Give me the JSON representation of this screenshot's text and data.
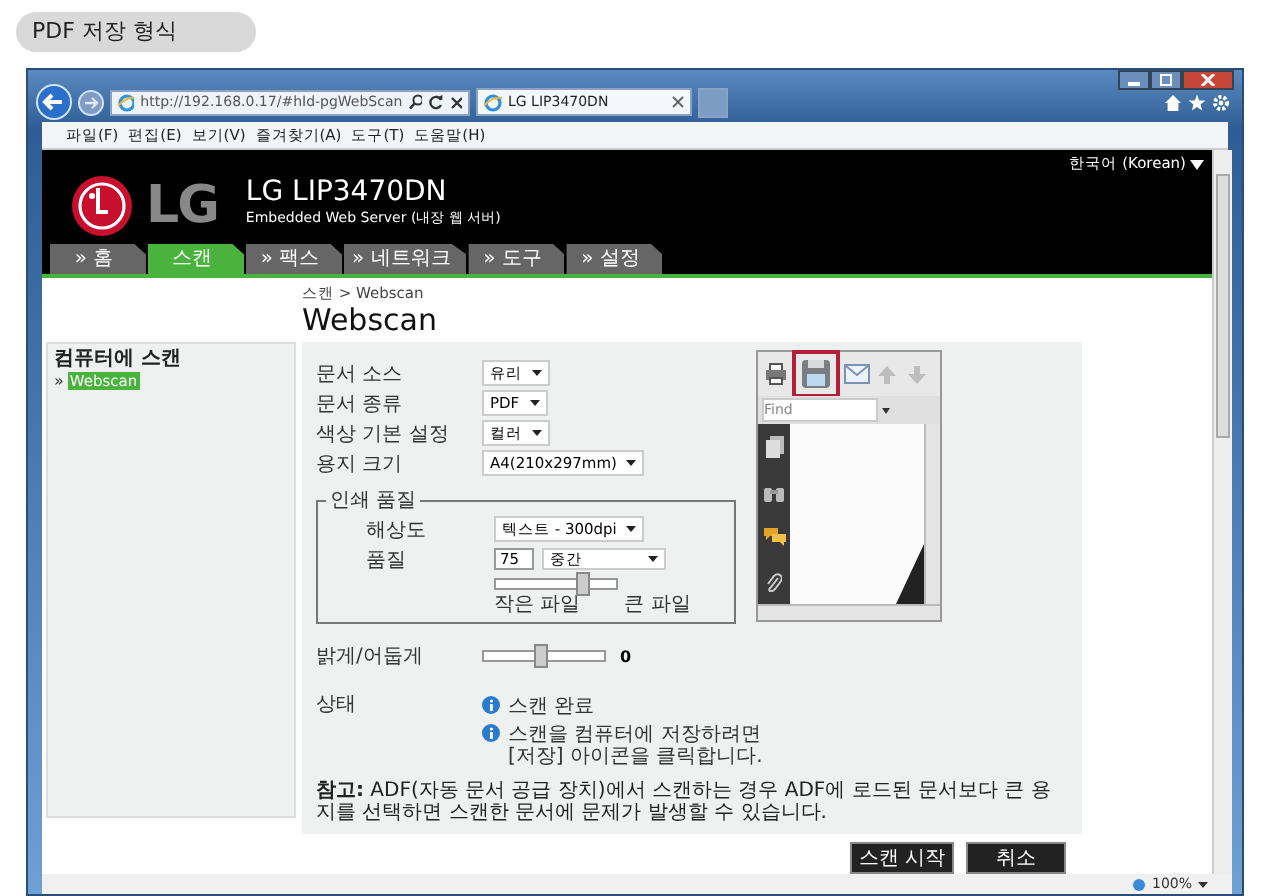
{
  "heading": "PDF 저장 형식",
  "browser": {
    "address": "http://192.168.0.17/#hId-pgWebScan",
    "tab_title": "LG LIP3470DN",
    "menu": [
      "파일(F)",
      "편집(E)",
      "보기(V)",
      "즐겨찾기(A)",
      "도구(T)",
      "도움말(H)"
    ],
    "zoom": "100%"
  },
  "header": {
    "logo_text": "LG",
    "title": "LG LIP3470DN",
    "subtitle": "Embedded Web Server (내장 웹 서버)",
    "language": "한국어 (Korean)"
  },
  "nav_tabs": [
    {
      "label": "» 홈",
      "selected": false
    },
    {
      "label": "스캔",
      "selected": true
    },
    {
      "label": "» 팩스",
      "selected": false
    },
    {
      "label": "» 네트워크",
      "selected": false
    },
    {
      "label": "» 도구",
      "selected": false
    },
    {
      "label": "» 설정",
      "selected": false
    }
  ],
  "breadcrumb": "스캔 > Webscan",
  "page_title": "Webscan",
  "sidebar": {
    "heading": "컴퓨터에 스캔",
    "items": [
      {
        "bullet": "»",
        "label": "Webscan",
        "selected": true
      }
    ]
  },
  "fields": [
    {
      "label": "문서 소스",
      "value": "유리"
    },
    {
      "label": "문서 종류",
      "value": "PDF"
    },
    {
      "label": "색상 기본 설정",
      "value": "컬러"
    },
    {
      "label": "용지 크기",
      "value": "A4(210x297mm)"
    }
  ],
  "quality_group": {
    "legend": "인쇄 품질",
    "resolution": {
      "label": "해상도",
      "value": "텍스트 - 300dpi"
    },
    "quality": {
      "label": "품질",
      "value": "75",
      "preset": "중간"
    },
    "slider": {
      "level": 0.72
    },
    "min_label": "작은 파일",
    "max_label": "큰 파일"
  },
  "brightness": {
    "label": "밝게/어둡게",
    "level": 0.47,
    "reading": "0"
  },
  "status": {
    "label": "상태",
    "messages": [
      "스캔 완료",
      "스캔을 컴퓨터에 저장하려면 [저장] 아이콘을 클릭합니다."
    ]
  },
  "note": "**참고:** ADF(자동 문서 공급 장치)에서 스캔하는 경우 ADF에 로드된 문서보다 큰 용지를 선택하면 스캔한 문서에 문제가 발생할 수 있습니다.",
  "viewer": {
    "find_placeholder": "Find",
    "tools": [
      {
        "kind": "print",
        "highlighted": false
      },
      {
        "kind": "save",
        "highlighted": true
      },
      {
        "kind": "email",
        "highlighted": false
      },
      {
        "kind": "up",
        "highlighted": false
      },
      {
        "kind": "down",
        "highlighted": false
      }
    ]
  },
  "buttons": [
    "스캔 시작",
    "취소"
  ]
}
